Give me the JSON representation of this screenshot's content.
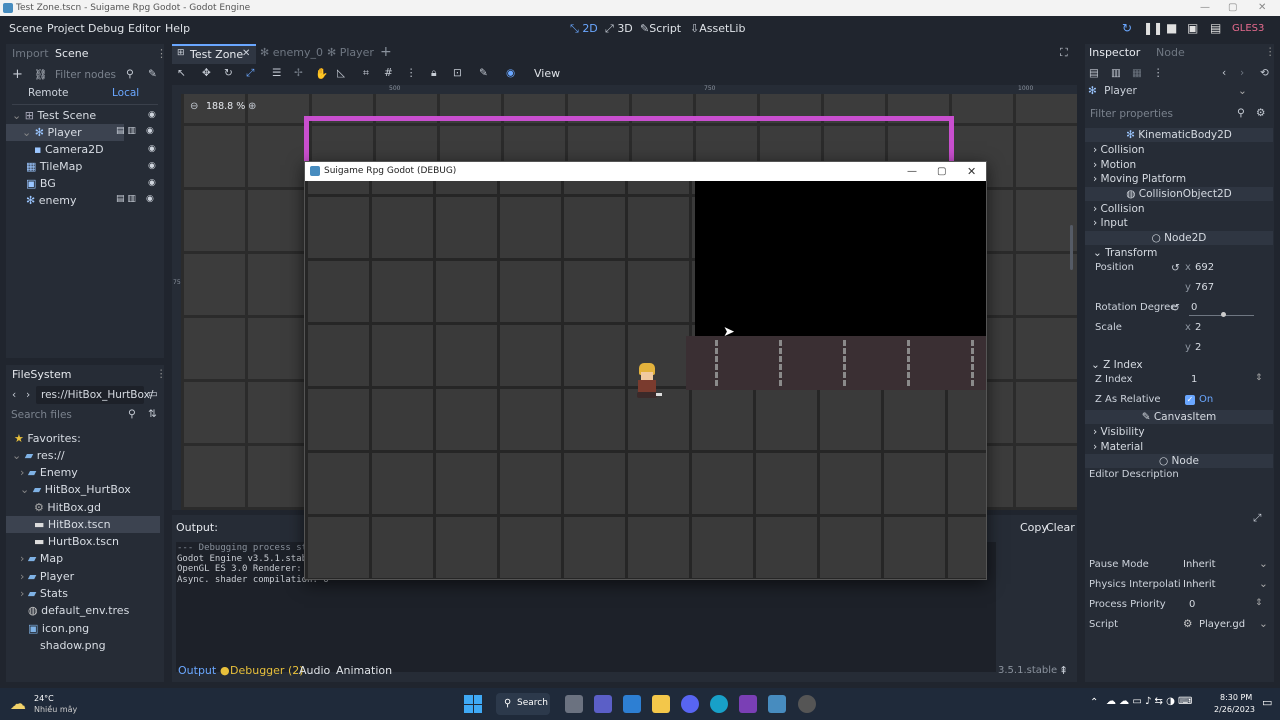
{
  "window_title": "Test Zone.tscn - Suigame Rpg Godot - Godot Engine",
  "menus": [
    "Scene",
    "Project",
    "Debug",
    "Editor",
    "Help"
  ],
  "workspaces": {
    "w2d": "2D",
    "w3d": "3D",
    "script": "Script",
    "assetlib": "AssetLib"
  },
  "renderer": "GLES3",
  "left_dock": {
    "tabs": {
      "import": "Import",
      "scene": "Scene"
    },
    "filter_placeholder": "Filter nodes",
    "remote": "Remote",
    "local": "Local",
    "tree": [
      "Test Scene",
      "Player",
      "Camera2D",
      "TileMap",
      "BG",
      "enemy"
    ]
  },
  "filesystem": {
    "title": "FileSystem",
    "path": "res://HitBox_HurtBox/",
    "search_placeholder": "Search files",
    "items": [
      "Favorites:",
      "res://",
      "Enemy",
      "HitBox_HurtBox",
      "HitBox.gd",
      "HitBox.tscn",
      "HurtBox.tscn",
      "Map",
      "Player",
      "Stats",
      "default_env.tres",
      "icon.png",
      "shadow.png"
    ]
  },
  "editor_tabs": [
    "Test Zone",
    "enemy_0",
    "Player"
  ],
  "toolbar": {
    "view": "View"
  },
  "zoom": "188.8 %",
  "ruler": {
    "r500": "500",
    "r750": "750",
    "r1000": "1000",
    "v750": "750"
  },
  "game_window": {
    "title": "Suigame Rpg Godot (DEBUG)"
  },
  "output": {
    "title": "Output:",
    "copy": "Copy",
    "clear": "Clear",
    "lines": [
      "--- Debugging process st",
      "Godot Engine v3.5.1.stab",
      "OpenGL ES 3.0 Renderer: ",
      "Async. shader compilation: O"
    ]
  },
  "bottom_tabs": {
    "output": "Output",
    "debugger": "Debugger (2)",
    "audio": "Audio",
    "animation": "Animation",
    "version": "3.5.1.stable"
  },
  "inspector": {
    "tabs": {
      "inspector": "Inspector",
      "node": "Node"
    },
    "object": "Player",
    "filter_placeholder": "Filter properties",
    "classes": {
      "kinematic": "KinematicBody2D",
      "collisionobj": "CollisionObject2D",
      "node2d": "Node2D",
      "canvasitem": "CanvasItem",
      "node": "Node"
    },
    "sections": {
      "collision": "Collision",
      "motion": "Motion",
      "moving_platform": "Moving Platform",
      "collision2": "Collision",
      "input": "Input",
      "transform": "Transform",
      "zindex": "Z Index",
      "visibility": "Visibility",
      "material": "Material"
    },
    "position_label": "Position",
    "pos_x": "692",
    "pos_y": "767",
    "rotation_label": "Rotation Degree",
    "rotation": "0",
    "scale_label": "Scale",
    "scale_x": "2",
    "scale_y": "2",
    "zindex_label": "Z Index",
    "zindex": "1",
    "zrel_label": "Z As Relative",
    "zrel": "On",
    "editor_description": "Editor Description",
    "pause_label": "Pause Mode",
    "pause": "Inherit",
    "physics_label": "Physics Interpolati",
    "physics": "Inherit",
    "priority_label": "Process Priority",
    "priority": "0",
    "script_label": "Script",
    "script": "Player.gd",
    "x": "x",
    "y": "y"
  },
  "taskbar": {
    "temp": "24°C",
    "weather": "Nhiều mây",
    "search": "Search",
    "time": "8:30 PM",
    "date": "2/26/2023"
  }
}
